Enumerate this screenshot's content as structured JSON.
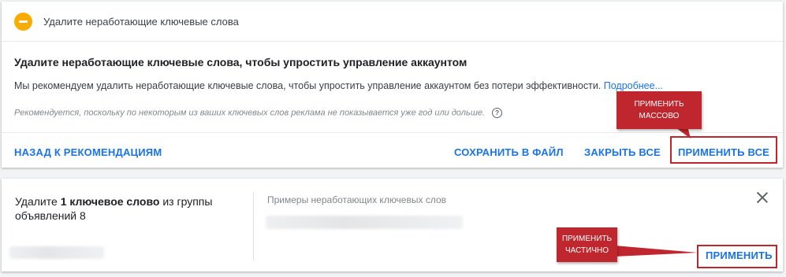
{
  "card1": {
    "header_title": "Удалите неработающие ключевые слова",
    "title": "Удалите неработающие ключевые слова, чтобы упростить управление аккаунтом",
    "description": "Мы рекомендуем удалить неработающие ключевые слова, чтобы упростить управление аккаунтом без потери эффективности.",
    "more_link": "Подробнее...",
    "note": "Рекомендуется, поскольку по некоторым из ваших ключевых слов реклама не показывается уже год или дольше.",
    "help_glyph": "?",
    "buttons": {
      "back": "НАЗАД К РЕКОМЕНДАЦИЯМ",
      "save": "СОХРАНИТЬ В ФАЙЛ",
      "close_all": "ЗАКРЫТЬ ВСЕ",
      "apply_all": "ПРИМЕНИТЬ ВСЕ"
    }
  },
  "card2": {
    "text_prefix": "Удалите ",
    "text_bold": "1 ключевое слово",
    "text_suffix": " из группы объявлений 8",
    "examples_heading": "Примеры неработающих ключевых слов",
    "apply": "ПРИМЕНИТЬ"
  },
  "callouts": {
    "mass_line1": "ПРИМЕНИТЬ",
    "mass_line2": "МАССОВО",
    "partial_line1": "ПРИМЕНИТЬ",
    "partial_line2": "ЧАСТИЧНО"
  },
  "colors": {
    "accent": "#1a73e8",
    "status": "#f9ab00",
    "callout": "#c0262d"
  },
  "icons": {
    "status": "minus-circle-icon",
    "help": "help-circle-icon",
    "close": "close-icon"
  }
}
